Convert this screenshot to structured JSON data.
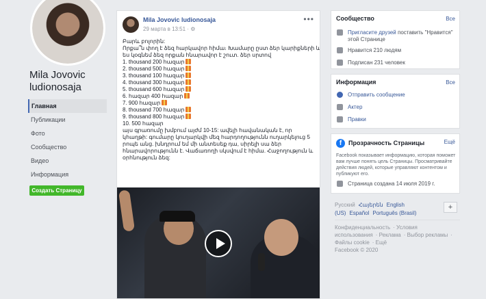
{
  "page": {
    "name": "Mila Jovovic ludionosaja",
    "nav": [
      {
        "label": "Главная",
        "active": true
      },
      {
        "label": "Публикации",
        "active": false
      },
      {
        "label": "Фото",
        "active": false
      },
      {
        "label": "Сообщество",
        "active": false
      },
      {
        "label": "Видео",
        "active": false
      },
      {
        "label": "Информация",
        "active": false
      }
    ],
    "create_page_label": "Создать Страницу"
  },
  "post": {
    "author": "Mila Jovovic ludionosaja",
    "date": "29 марта в 13:51 · ",
    "more": "•••",
    "lines": [
      "Բարև բոլորին:",
      "Որքա՞ն փող է ձեզ հարկավոր հիմա։ Խամարը ըստ ձեր կարիքների և",
      "ես կօգնեմ ձեզ որքան հնարավոր է շուտ. ձեր սրտով",
      "1. thousand 200 հազար",
      "2. thousand 500 հազար",
      "3. thousand 100 հազար",
      "4. thousand 300 հազար",
      "5. thousand 600 հազար",
      "6. հազար 400 հազար",
      "7.  900 հազար",
      "8. thousand 700 հազար",
      "9. thousand 800 հազար",
      "10. 500 հազար"
    ],
    "paragraph": "այս գրառումը խմբում այժմ 10-15: ավելի հավանական է, որ կհաղթի: գումարը կուղարկվի մեզ հարդողությունն ուղարկելուց 5 րոպե անց. խնդրում եմ մի անտեսեք դա, սիրելի սա ձեր հնարավորությունն է. Վաճառողի սկսվում է հիմա. Հաջողություն և օրհնություն ձեզ:"
  },
  "community": {
    "title": "Сообщество",
    "see_all": "Все",
    "invite_link": "Пригласите друзей",
    "invite_rest": " поставить \"Нравится\" этой Странице",
    "likes": "Нравится 210 людям",
    "follows": "Подписан 231 человек"
  },
  "info": {
    "title": "Информация",
    "see_all": "Все",
    "message": "Отправить сообщение",
    "category1": "Актер",
    "category2": "Правки"
  },
  "transparency": {
    "title": "Прозрачность Страницы",
    "more": "Ещё",
    "description": "Facebook показывает информацию, которая поможет вам лучше понять цель Страницы. Просматривайте действия людей, которые управляют контентом и публикуют его.",
    "created": "Страница создана 14 июля 2019 г."
  },
  "languages": [
    "Русский",
    "Հայերեն",
    "English (US)",
    "Español",
    "Português (Brasil)"
  ],
  "footer": {
    "links": [
      "Конфиденциальность",
      "Условия использования",
      "Реклама",
      "Выбор рекламы",
      "Файлы cookie",
      "Ещё"
    ],
    "copyright": "Facebook © 2020"
  }
}
